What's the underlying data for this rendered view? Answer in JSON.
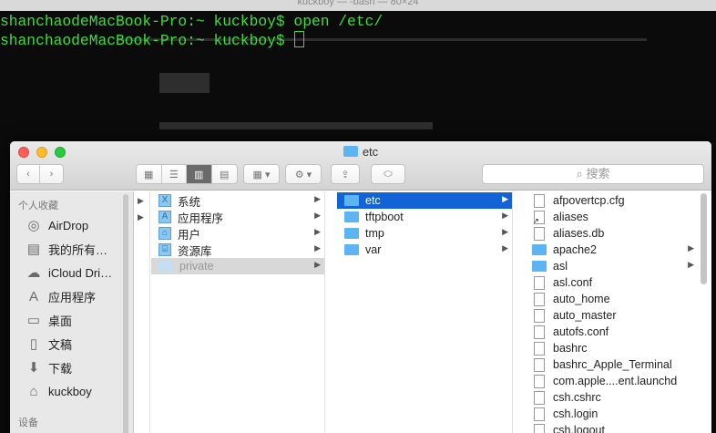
{
  "terminal": {
    "title": "kuckboy — -bash — 80×24",
    "line1": "shanchaodeMacBook-Pro:~ kuckboy$ open /etc/",
    "line2": "shanchaodeMacBook-Pro:~ kuckboy$ "
  },
  "finder": {
    "title": "etc",
    "search_placeholder": "搜索",
    "sidebar": {
      "favorites_header": "个人收藏",
      "devices_header": "设备",
      "items": [
        {
          "label": "AirDrop",
          "icon": "airdrop-icon"
        },
        {
          "label": "我的所有…",
          "icon": "all-files-icon"
        },
        {
          "label": "iCloud Dri…",
          "icon": "cloud-icon"
        },
        {
          "label": "应用程序",
          "icon": "applications-icon"
        },
        {
          "label": "桌面",
          "icon": "desktop-icon"
        },
        {
          "label": "文稿",
          "icon": "documents-icon"
        },
        {
          "label": "下载",
          "icon": "download-icon"
        },
        {
          "label": "kuckboy",
          "icon": "home-icon"
        }
      ]
    },
    "column1": [
      "系统",
      "应用程序",
      "用户",
      "资源库",
      "private"
    ],
    "column2": [
      "etc",
      "tftpboot",
      "tmp",
      "var"
    ],
    "column3": [
      {
        "name": "afpovertcp.cfg",
        "kind": "file"
      },
      {
        "name": "aliases",
        "kind": "alias"
      },
      {
        "name": "aliases.db",
        "kind": "file"
      },
      {
        "name": "apache2",
        "kind": "folder"
      },
      {
        "name": "asl",
        "kind": "folder"
      },
      {
        "name": "asl.conf",
        "kind": "file"
      },
      {
        "name": "auto_home",
        "kind": "file"
      },
      {
        "name": "auto_master",
        "kind": "file"
      },
      {
        "name": "autofs.conf",
        "kind": "file"
      },
      {
        "name": "bashrc",
        "kind": "file"
      },
      {
        "name": "bashrc_Apple_Terminal",
        "kind": "file"
      },
      {
        "name": "com.apple....ent.launchd",
        "kind": "file"
      },
      {
        "name": "csh.cshrc",
        "kind": "file"
      },
      {
        "name": "csh.login",
        "kind": "file"
      },
      {
        "name": "csh.logout",
        "kind": "file"
      }
    ],
    "colors": {
      "selection": "#1163d7",
      "folder": "#5cb4f0",
      "terminal_text": "#38e038"
    }
  }
}
